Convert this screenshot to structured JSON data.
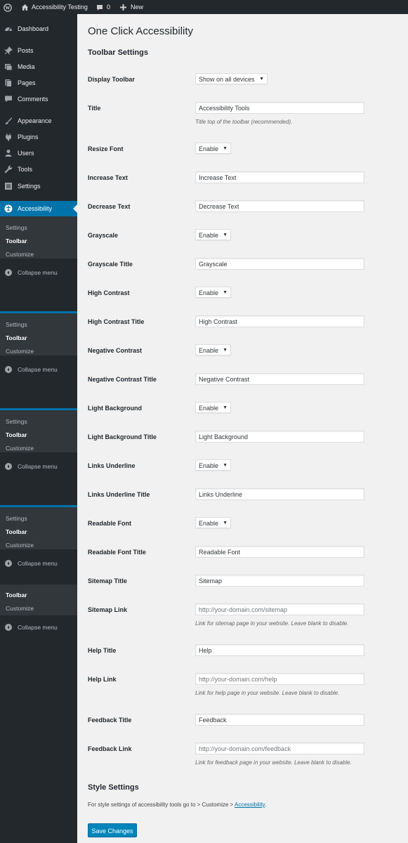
{
  "admin_bar": {
    "site_name": "Accessibility Testing",
    "comments_count": "0",
    "new_label": "New"
  },
  "menu": [
    {
      "label": "Dashboard",
      "icon": "dashboard-icon"
    },
    {
      "label": "Posts",
      "icon": "pushpin-icon"
    },
    {
      "label": "Media",
      "icon": "media-icon"
    },
    {
      "label": "Pages",
      "icon": "pages-icon"
    },
    {
      "label": "Comments",
      "icon": "comment-icon"
    },
    {
      "label": "Appearance",
      "icon": "paintbrush-icon"
    },
    {
      "label": "Plugins",
      "icon": "plugin-icon"
    },
    {
      "label": "Users",
      "icon": "users-icon"
    },
    {
      "label": "Tools",
      "icon": "wrench-icon"
    },
    {
      "label": "Settings",
      "icon": "settings-icon"
    },
    {
      "label": "Accessibility",
      "icon": "accessibility-icon"
    }
  ],
  "submenu": {
    "settings": "Settings",
    "toolbar": "Toolbar",
    "customize": "Customize",
    "collapse": "Collapse menu"
  },
  "page": {
    "title": "One Click Accessibility",
    "toolbar_heading": "Toolbar Settings",
    "style_heading": "Style Settings",
    "style_text": "For style settings of accessibility tools go to > Customize > ",
    "style_link": "Accessibility",
    "style_text_end": ".",
    "save": "Save Changes"
  },
  "fields": {
    "display_toolbar": {
      "label": "Display Toolbar",
      "value": "Show on all devices"
    },
    "title": {
      "label": "Title",
      "value": "Accessibility Tools",
      "desc": "Title top of the toolbar (recommended)."
    },
    "resize_font": {
      "label": "Resize Font",
      "value": "Enable"
    },
    "increase_text": {
      "label": "Increase Text",
      "value": "Increase Text"
    },
    "decrease_text": {
      "label": "Decrease Text",
      "value": "Decrease Text"
    },
    "grayscale": {
      "label": "Grayscale",
      "value": "Enable"
    },
    "grayscale_title": {
      "label": "Grayscale Title",
      "value": "Grayscale"
    },
    "high_contrast": {
      "label": "High Contrast",
      "value": "Enable"
    },
    "high_contrast_title": {
      "label": "High Contrast Title",
      "value": "High Contrast"
    },
    "negative_contrast": {
      "label": "Negative Contrast",
      "value": "Enable"
    },
    "negative_contrast_title": {
      "label": "Negative Contrast Title",
      "value": "Negative Contrast"
    },
    "light_background": {
      "label": "Light Background",
      "value": "Enable"
    },
    "light_background_title": {
      "label": "Light Background Title",
      "value": "Light Background"
    },
    "links_underline": {
      "label": "Links Underline",
      "value": "Enable"
    },
    "links_underline_title": {
      "label": "Links Underline Title",
      "value": "Links Underline"
    },
    "readable_font": {
      "label": "Readable Font",
      "value": "Enable"
    },
    "readable_font_title": {
      "label": "Readable Font Title",
      "value": "Readable Font"
    },
    "sitemap_title": {
      "label": "Sitemap Title",
      "value": "Sitemap"
    },
    "sitemap_link": {
      "label": "Sitemap Link",
      "placeholder": "http://your-domain.com/sitemap",
      "desc": "Link for sitemap page in your website. Leave blank to disable."
    },
    "help_title": {
      "label": "Help Title",
      "value": "Help"
    },
    "help_link": {
      "label": "Help Link",
      "placeholder": "http://your-domain.com/help",
      "desc": "Link for help page in your website. Leave blank to disable."
    },
    "feedback_title": {
      "label": "Feedback Title",
      "value": "Feedback"
    },
    "feedback_link": {
      "label": "Feedback Link",
      "placeholder": "http://your-domain.com/feedback",
      "desc": "Link for feedback page in your website. Leave blank to disable."
    }
  },
  "colors": {
    "admin_dark": "#23282d",
    "accent": "#0073aa",
    "button": "#0085ba"
  }
}
